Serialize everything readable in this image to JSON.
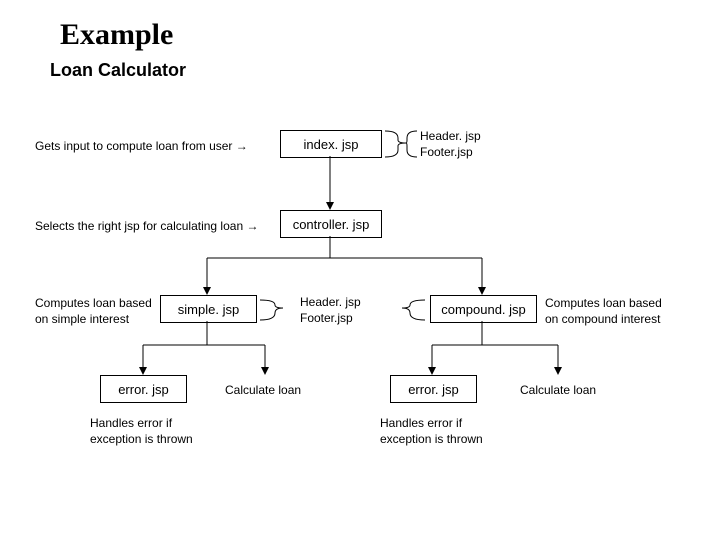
{
  "title": "Example",
  "subtitle": "Loan Calculator",
  "notes": {
    "n1": "Gets input to compute loan from user →",
    "n2": "Selects the right jsp for calculating loan →",
    "n3": "Computes loan based\non simple interest",
    "n4": "Computes loan based\non compound interest",
    "nerr1": "Handles error if\nexception is thrown",
    "nerr2": "Handles error if\nexception is thrown",
    "headerfooter1": "Header. jsp\nFooter.jsp",
    "headerfooter2": "Header. jsp\nFooter.jsp",
    "calc1": "Calculate loan",
    "calc2": "Calculate loan"
  },
  "boxes": {
    "index": "index. jsp",
    "controller": "controller. jsp",
    "simple": "simple. jsp",
    "compound": "compound. jsp",
    "err1": "error. jsp",
    "err2": "error. jsp"
  }
}
